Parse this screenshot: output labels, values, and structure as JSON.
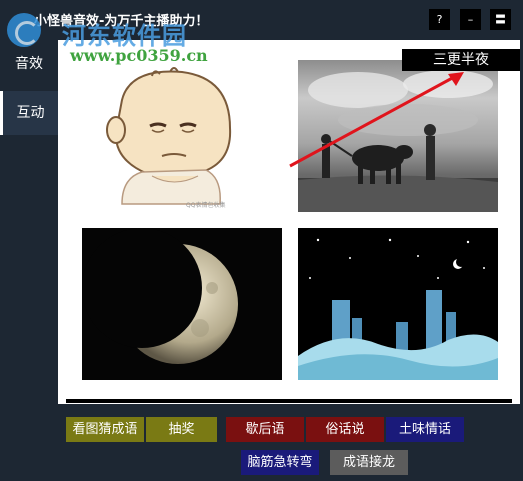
{
  "window": {
    "title": "小怪兽音效-为万千主播助力！",
    "buttons": [
      "?",
      "–",
      "〓"
    ]
  },
  "watermark": {
    "site_name": "河东软件园",
    "url": "www.pc0359.cn"
  },
  "sidebar": {
    "items": [
      {
        "label": "音效"
      },
      {
        "label": "互动"
      }
    ]
  },
  "main": {
    "images": [
      {
        "name": "bored-baby-cartoon",
        "caption": "QQ表情包收集"
      },
      {
        "name": "farmer-plowing-with-ox"
      },
      {
        "name": "eclipsed-moon"
      },
      {
        "name": "night-city-skyline"
      }
    ],
    "answer_label": "三更半夜",
    "arrow_color": "#e0141c"
  },
  "games": {
    "buttons": [
      {
        "label": "看图猜成语",
        "color": "#7a7a14"
      },
      {
        "label": "抽奖",
        "color": "#7a7a14"
      },
      {
        "label": "歇后语",
        "color": "#7a1010"
      },
      {
        "label": "俗话说",
        "color": "#7a1010"
      },
      {
        "label": "土味情话",
        "color": "#1a1a7a"
      },
      {
        "label": "脑筋急转弯",
        "color": "#1a1a7a"
      },
      {
        "label": "成语接龙",
        "color": "#5c5c5c"
      }
    ]
  }
}
